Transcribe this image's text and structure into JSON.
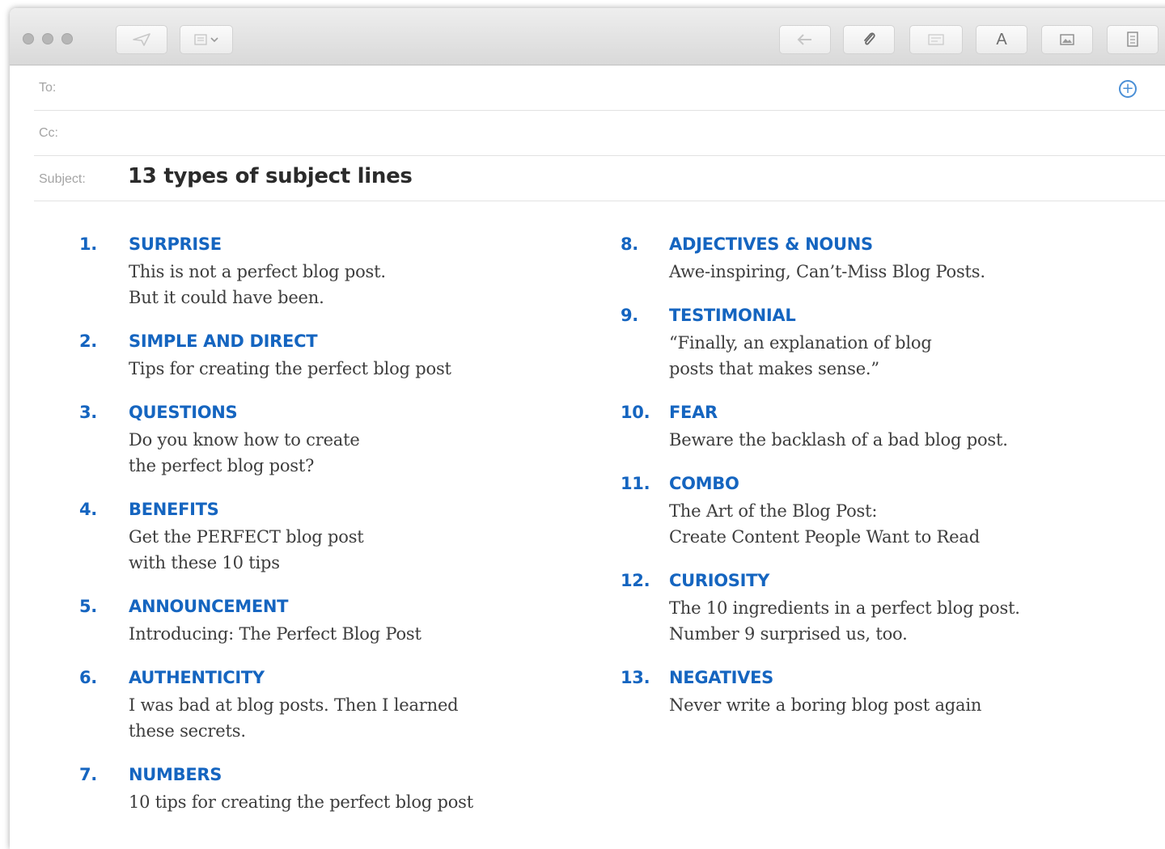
{
  "toolbar": {
    "left_buttons": [
      "send-icon",
      "header-fields-icon"
    ],
    "right_buttons": [
      "reply-icon",
      "attachment-icon",
      "format-bar-icon",
      "fonts-icon",
      "photo-browser-icon",
      "notes-icon"
    ],
    "fonts_glyph": "A"
  },
  "header": {
    "to_label": "To:",
    "cc_label": "Cc:",
    "subject_label": "Subject:",
    "subject_value": "13 types of subject lines"
  },
  "body": {
    "left_column": [
      {
        "number": "1.",
        "title": "SURPRISE",
        "lines": [
          "This is not a perfect blog post.",
          "But it could have been."
        ]
      },
      {
        "number": "2.",
        "title": "SIMPLE AND DIRECT",
        "lines": [
          "Tips for creating the perfect blog post"
        ]
      },
      {
        "number": "3.",
        "title": "QUESTIONS",
        "lines": [
          "Do you know how to create",
          "the perfect blog post?"
        ]
      },
      {
        "number": "4.",
        "title": "BENEFITS",
        "lines": [
          "Get the PERFECT blog post",
          "with these 10 tips"
        ]
      },
      {
        "number": "5.",
        "title": "ANNOUNCEMENT",
        "lines": [
          "Introducing: The Perfect Blog Post"
        ]
      },
      {
        "number": "6.",
        "title": "AUTHENTICITY",
        "lines": [
          "I was bad at blog posts. Then I learned",
          "these secrets."
        ]
      },
      {
        "number": "7.",
        "title": "NUMBERS",
        "lines": [
          "10 tips for creating the perfect blog post"
        ]
      }
    ],
    "right_column": [
      {
        "number": "8.",
        "title": "ADJECTIVES & NOUNS",
        "lines": [
          "Awe-inspiring, Can’t-Miss Blog Posts."
        ]
      },
      {
        "number": "9.",
        "title": "TESTIMONIAL",
        "lines": [
          "“Finally, an explanation of blog",
          "posts that makes sense.”"
        ]
      },
      {
        "number": "10.",
        "title": "FEAR",
        "lines": [
          "Beware the backlash of a bad blog post."
        ]
      },
      {
        "number": "11.",
        "title": "COMBO",
        "lines": [
          "The Art of the Blog Post:",
          "Create Content People Want to Read"
        ]
      },
      {
        "number": "12.",
        "title": "CURIOSITY",
        "lines": [
          "The 10 ingredients in a perfect blog post.",
          "Number 9 surprised us, too."
        ]
      },
      {
        "number": "13.",
        "title": "NEGATIVES",
        "lines": [
          "Never write a boring blog post again"
        ]
      }
    ]
  },
  "colors": {
    "accent": "#1565c0",
    "body_text": "#3d3d3d",
    "label_gray": "#a4a4a4",
    "add_contact_blue": "#4a8fd6"
  }
}
